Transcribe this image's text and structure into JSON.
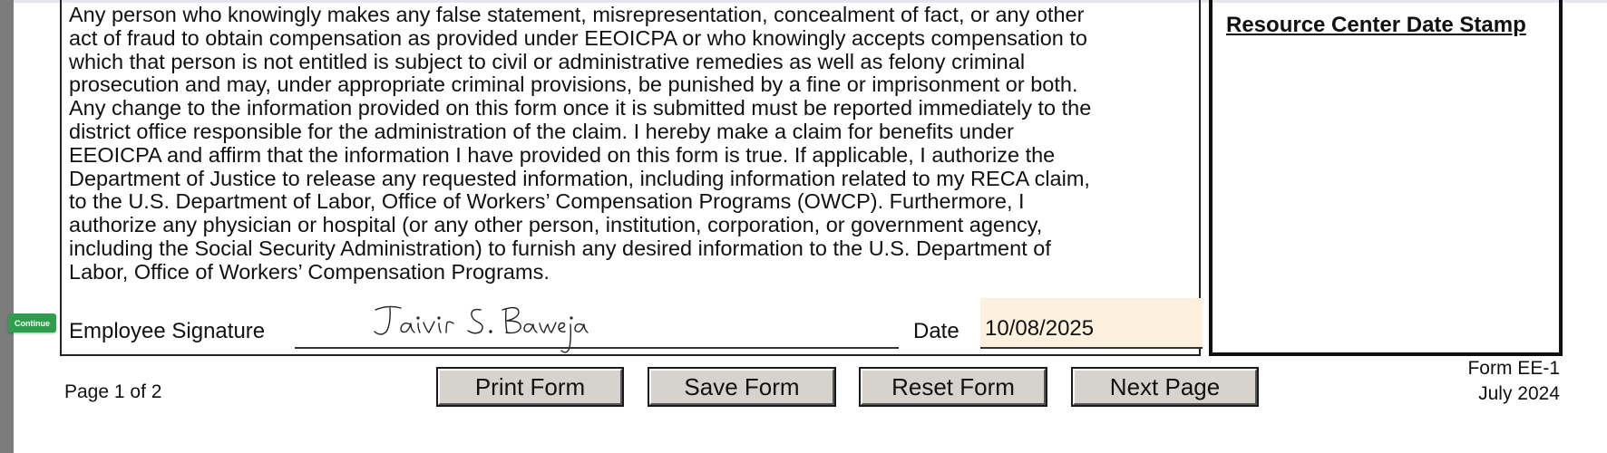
{
  "certification": {
    "lines": [
      "Any person who knowingly makes any false statement, misrepresentation, concealment of fact, or any other",
      "act of fraud to obtain compensation as provided under EEOICPA or who knowingly accepts compensation to",
      "which that person is not entitled is subject to civil or administrative remedies as well as felony criminal",
      "prosecution and may, under appropriate criminal provisions, be punished by a fine or imprisonment or both.",
      "Any change to the information provided on this form once it is submitted must be reported immediately to the",
      "district office responsible for the administration of the claim. I hereby make a claim for benefits under",
      "EEOICPA and affirm that the information I have provided on this form is true. If applicable, I authorize the",
      "Department of Justice to release any requested information, including information related to my RECA claim,",
      "to the U.S. Department of Labor, Office of Workers’ Compensation Programs (OWCP). Furthermore, I",
      "authorize any physician or hospital (or any other person, institution, corporation, or government agency,",
      "including the Social Security Administration) to furnish any desired information to the U.S. Department of",
      "Labor, Office of Workers’ Compensation Programs."
    ]
  },
  "stamp": {
    "title": "Resource Center Date Stamp"
  },
  "continue_label": "Continue",
  "signature": {
    "label": "Employee Signature",
    "handwritten": "Jaivir S. Baweja"
  },
  "date": {
    "label": "Date",
    "value": "10/08/2025"
  },
  "footer": {
    "page_info": "Page 1 of 2",
    "buttons": {
      "print": "Print Form",
      "save": "Save Form",
      "reset": "Reset Form",
      "next": "Next Page"
    },
    "form_id": "Form EE-1",
    "form_date": "July 2024"
  },
  "colors": {
    "continue_green": "#2f9e4d",
    "date_field_bg": "#fdf0dc",
    "button_face": "#d6d3ce"
  }
}
